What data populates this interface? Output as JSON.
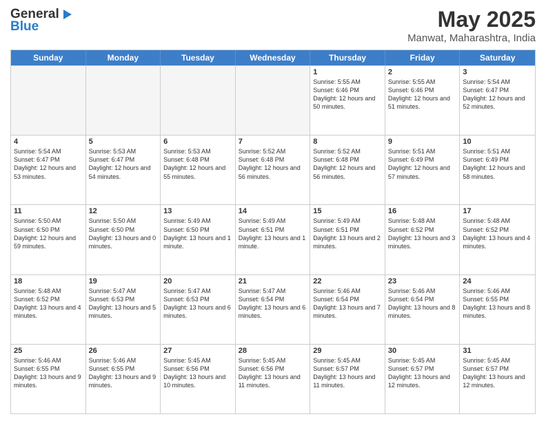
{
  "logo": {
    "line1": "General",
    "line2": "Blue"
  },
  "title": {
    "month_year": "May 2025",
    "location": "Manwat, Maharashtra, India"
  },
  "header_days": [
    "Sunday",
    "Monday",
    "Tuesday",
    "Wednesday",
    "Thursday",
    "Friday",
    "Saturday"
  ],
  "weeks": [
    [
      {
        "day": "",
        "info": "",
        "empty": true
      },
      {
        "day": "",
        "info": "",
        "empty": true
      },
      {
        "day": "",
        "info": "",
        "empty": true
      },
      {
        "day": "",
        "info": "",
        "empty": true
      },
      {
        "day": "1",
        "info": "Sunrise: 5:55 AM\nSunset: 6:46 PM\nDaylight: 12 hours\nand 50 minutes.",
        "empty": false
      },
      {
        "day": "2",
        "info": "Sunrise: 5:55 AM\nSunset: 6:46 PM\nDaylight: 12 hours\nand 51 minutes.",
        "empty": false
      },
      {
        "day": "3",
        "info": "Sunrise: 5:54 AM\nSunset: 6:47 PM\nDaylight: 12 hours\nand 52 minutes.",
        "empty": false
      }
    ],
    [
      {
        "day": "4",
        "info": "Sunrise: 5:54 AM\nSunset: 6:47 PM\nDaylight: 12 hours\nand 53 minutes.",
        "empty": false
      },
      {
        "day": "5",
        "info": "Sunrise: 5:53 AM\nSunset: 6:47 PM\nDaylight: 12 hours\nand 54 minutes.",
        "empty": false
      },
      {
        "day": "6",
        "info": "Sunrise: 5:53 AM\nSunset: 6:48 PM\nDaylight: 12 hours\nand 55 minutes.",
        "empty": false
      },
      {
        "day": "7",
        "info": "Sunrise: 5:52 AM\nSunset: 6:48 PM\nDaylight: 12 hours\nand 56 minutes.",
        "empty": false
      },
      {
        "day": "8",
        "info": "Sunrise: 5:52 AM\nSunset: 6:48 PM\nDaylight: 12 hours\nand 56 minutes.",
        "empty": false
      },
      {
        "day": "9",
        "info": "Sunrise: 5:51 AM\nSunset: 6:49 PM\nDaylight: 12 hours\nand 57 minutes.",
        "empty": false
      },
      {
        "day": "10",
        "info": "Sunrise: 5:51 AM\nSunset: 6:49 PM\nDaylight: 12 hours\nand 58 minutes.",
        "empty": false
      }
    ],
    [
      {
        "day": "11",
        "info": "Sunrise: 5:50 AM\nSunset: 6:50 PM\nDaylight: 12 hours\nand 59 minutes.",
        "empty": false
      },
      {
        "day": "12",
        "info": "Sunrise: 5:50 AM\nSunset: 6:50 PM\nDaylight: 13 hours\nand 0 minutes.",
        "empty": false
      },
      {
        "day": "13",
        "info": "Sunrise: 5:49 AM\nSunset: 6:50 PM\nDaylight: 13 hours\nand 1 minute.",
        "empty": false
      },
      {
        "day": "14",
        "info": "Sunrise: 5:49 AM\nSunset: 6:51 PM\nDaylight: 13 hours\nand 1 minute.",
        "empty": false
      },
      {
        "day": "15",
        "info": "Sunrise: 5:49 AM\nSunset: 6:51 PM\nDaylight: 13 hours\nand 2 minutes.",
        "empty": false
      },
      {
        "day": "16",
        "info": "Sunrise: 5:48 AM\nSunset: 6:52 PM\nDaylight: 13 hours\nand 3 minutes.",
        "empty": false
      },
      {
        "day": "17",
        "info": "Sunrise: 5:48 AM\nSunset: 6:52 PM\nDaylight: 13 hours\nand 4 minutes.",
        "empty": false
      }
    ],
    [
      {
        "day": "18",
        "info": "Sunrise: 5:48 AM\nSunset: 6:52 PM\nDaylight: 13 hours\nand 4 minutes.",
        "empty": false
      },
      {
        "day": "19",
        "info": "Sunrise: 5:47 AM\nSunset: 6:53 PM\nDaylight: 13 hours\nand 5 minutes.",
        "empty": false
      },
      {
        "day": "20",
        "info": "Sunrise: 5:47 AM\nSunset: 6:53 PM\nDaylight: 13 hours\nand 6 minutes.",
        "empty": false
      },
      {
        "day": "21",
        "info": "Sunrise: 5:47 AM\nSunset: 6:54 PM\nDaylight: 13 hours\nand 6 minutes.",
        "empty": false
      },
      {
        "day": "22",
        "info": "Sunrise: 5:46 AM\nSunset: 6:54 PM\nDaylight: 13 hours\nand 7 minutes.",
        "empty": false
      },
      {
        "day": "23",
        "info": "Sunrise: 5:46 AM\nSunset: 6:54 PM\nDaylight: 13 hours\nand 8 minutes.",
        "empty": false
      },
      {
        "day": "24",
        "info": "Sunrise: 5:46 AM\nSunset: 6:55 PM\nDaylight: 13 hours\nand 8 minutes.",
        "empty": false
      }
    ],
    [
      {
        "day": "25",
        "info": "Sunrise: 5:46 AM\nSunset: 6:55 PM\nDaylight: 13 hours\nand 9 minutes.",
        "empty": false
      },
      {
        "day": "26",
        "info": "Sunrise: 5:46 AM\nSunset: 6:55 PM\nDaylight: 13 hours\nand 9 minutes.",
        "empty": false
      },
      {
        "day": "27",
        "info": "Sunrise: 5:45 AM\nSunset: 6:56 PM\nDaylight: 13 hours\nand 10 minutes.",
        "empty": false
      },
      {
        "day": "28",
        "info": "Sunrise: 5:45 AM\nSunset: 6:56 PM\nDaylight: 13 hours\nand 11 minutes.",
        "empty": false
      },
      {
        "day": "29",
        "info": "Sunrise: 5:45 AM\nSunset: 6:57 PM\nDaylight: 13 hours\nand 11 minutes.",
        "empty": false
      },
      {
        "day": "30",
        "info": "Sunrise: 5:45 AM\nSunset: 6:57 PM\nDaylight: 13 hours\nand 12 minutes.",
        "empty": false
      },
      {
        "day": "31",
        "info": "Sunrise: 5:45 AM\nSunset: 6:57 PM\nDaylight: 13 hours\nand 12 minutes.",
        "empty": false
      }
    ]
  ]
}
